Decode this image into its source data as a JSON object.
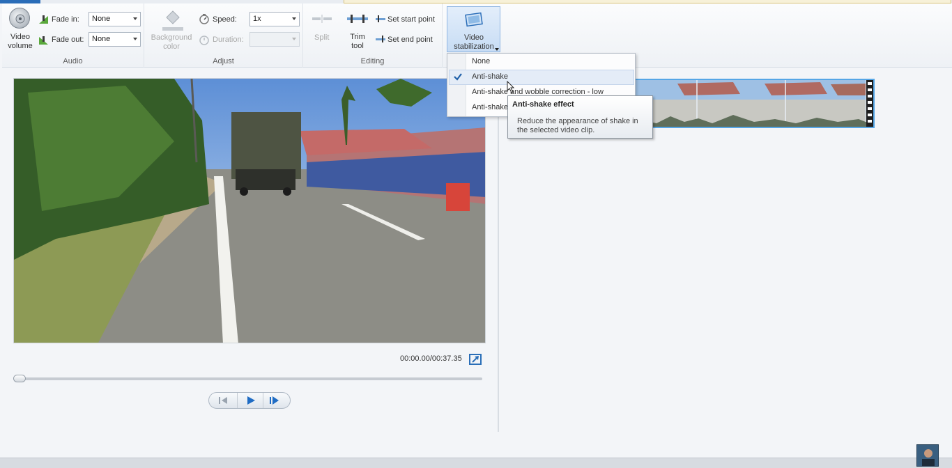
{
  "ribbon": {
    "audio": {
      "group_label": "Audio",
      "video_volume_label": "Video\nvolume",
      "fade_in_label": "Fade in:",
      "fade_in_value": "None",
      "fade_out_label": "Fade out:",
      "fade_out_value": "None"
    },
    "adjust": {
      "group_label": "Adjust",
      "background_color_label": "Background\ncolor",
      "speed_label": "Speed:",
      "speed_value": "1x",
      "duration_label": "Duration:",
      "duration_value": ""
    },
    "editing": {
      "group_label": "Editing",
      "split_label": "Split",
      "trim_tool_label": "Trim\ntool",
      "set_start_point_label": "Set start point",
      "set_end_point_label": "Set end point"
    },
    "stabilization": {
      "label": "Video\nstabilization"
    }
  },
  "dropdown": {
    "items": [
      {
        "label": "None",
        "checked": false
      },
      {
        "label": "Anti-shake",
        "checked": true
      },
      {
        "label": "Anti-shake and wobble correction - low",
        "checked": false
      },
      {
        "label": "Anti-shake",
        "checked": false
      }
    ]
  },
  "tooltip": {
    "title": "Anti-shake effect",
    "body": "Reduce the appearance of shake in the selected video clip."
  },
  "player": {
    "timecode": "00:00.00/00:37.35",
    "seek_position": 0
  },
  "colors": {
    "accent": "#2a6db8",
    "clip_border": "#55a6e6",
    "menu_highlight": "#e4ecf7"
  }
}
